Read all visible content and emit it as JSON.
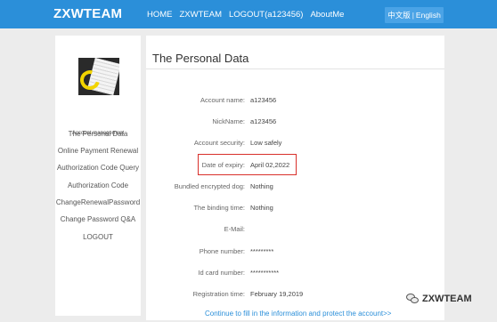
{
  "header": {
    "brand": "ZXWTEAM",
    "nav": [
      "HOME",
      "ZXWTEAM",
      "LOGOUT(a123456)",
      "AboutMe"
    ],
    "lang_cn": "中文版",
    "lang_sep": "|",
    "lang_en": "English"
  },
  "sidebar": {
    "avatar_caption": "Account management",
    "items": [
      "The Personal Data",
      "Online Payment Renewal",
      "Authorization Code Query",
      "Authorization Code",
      "ChangeRenewalPassword",
      "Change Password Q&A",
      "LOGOUT"
    ]
  },
  "main": {
    "title": "The Personal Data",
    "fields": [
      {
        "label": "Account name:",
        "value": "a123456"
      },
      {
        "label": "NickName:",
        "value": "a123456"
      },
      {
        "label": "Account security:",
        "value": "Low safely"
      },
      {
        "label": "Date of expiry:",
        "value": "April 02,2022"
      },
      {
        "label": "Bundled encrypted dog:",
        "value": "Nothing"
      },
      {
        "label": "The binding time:",
        "value": "Nothing"
      },
      {
        "label": "E-Mail:",
        "value": ""
      },
      {
        "label": "Phone number:",
        "value": "*********"
      },
      {
        "label": "Id card number:",
        "value": "***********"
      },
      {
        "label": "Registration time:",
        "value": "February 19,2019"
      }
    ],
    "cta": "Continue to fill in the information and protect the account>>"
  },
  "watermark": {
    "text": "ZXWTEAM"
  },
  "colors": {
    "topbar": "#2b8fd9",
    "highlight": "#d9302b",
    "link": "#2b8fd9"
  }
}
